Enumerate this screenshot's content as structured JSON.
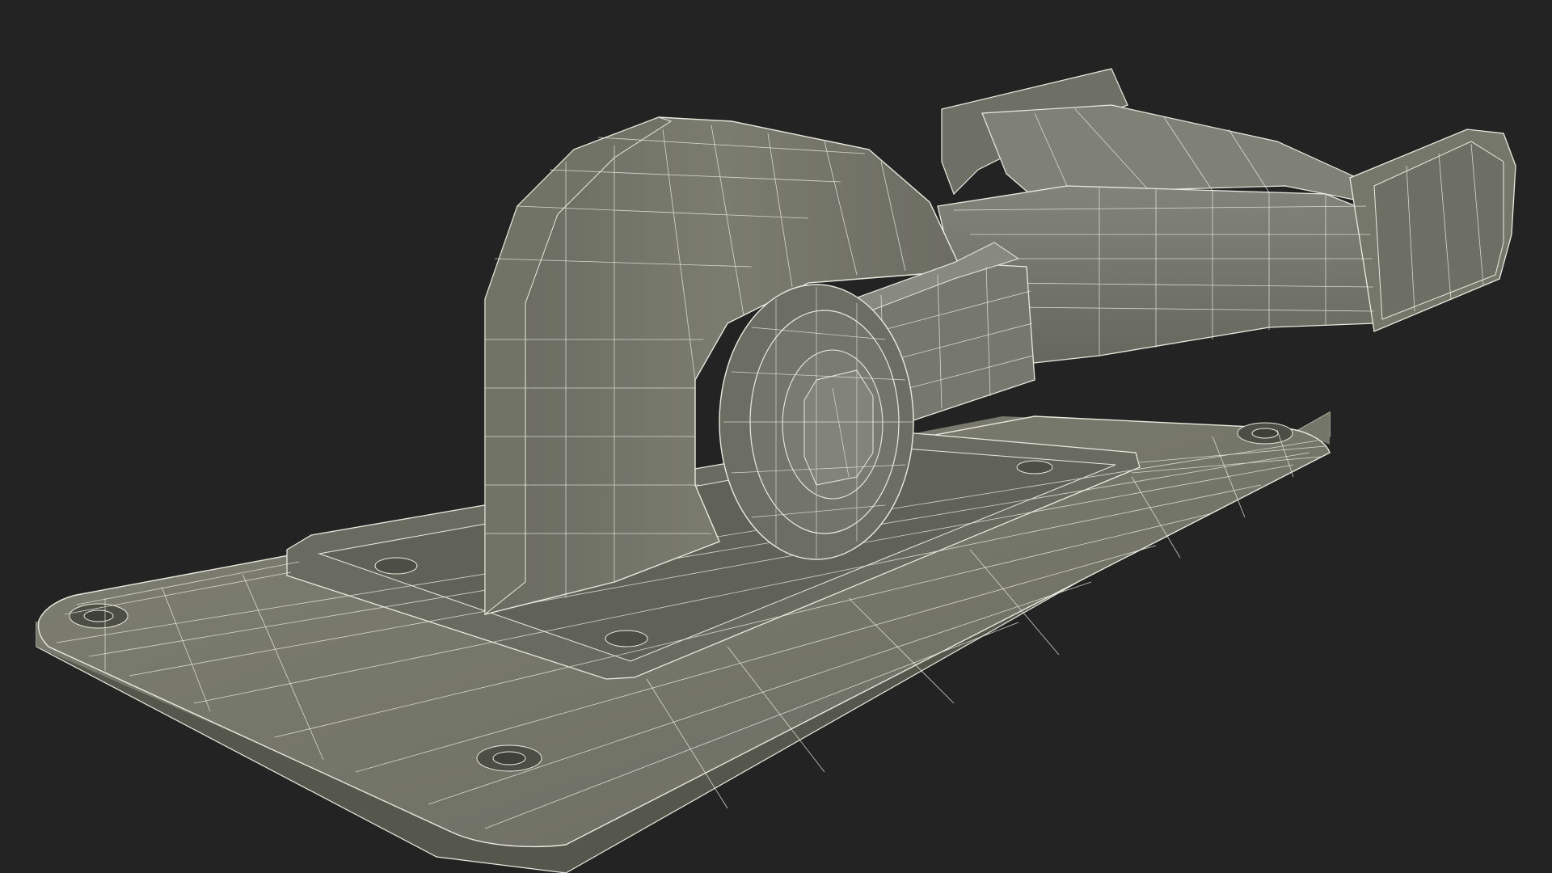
{
  "scene": {
    "subject": "wireframe-render-lever-clamp",
    "colors": {
      "background": "#232323",
      "surface_light": "#7c7d70",
      "surface_mid": "#6f7064",
      "surface_dark": "#5d5e53",
      "surface_shadow": "#4b4c43",
      "wire": "#e9eadf"
    }
  }
}
